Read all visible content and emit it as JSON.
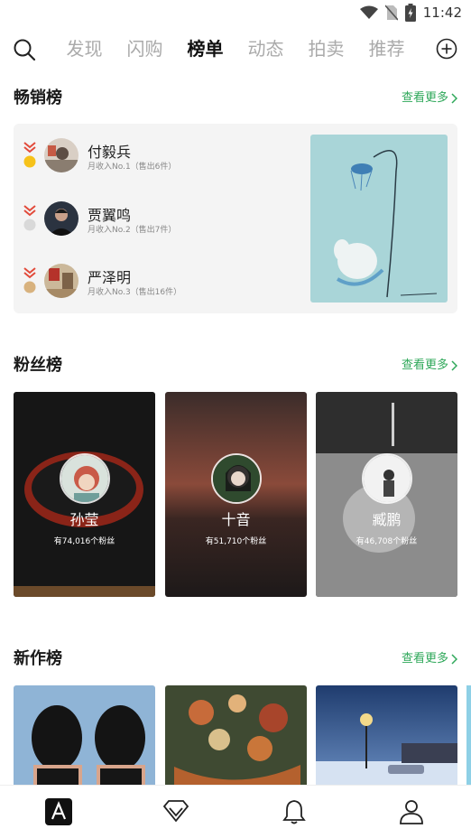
{
  "status_bar": {
    "time": "11:42",
    "icons": [
      "wifi-icon",
      "no-sim-icon",
      "battery-charging-icon"
    ]
  },
  "top_nav": {
    "tabs": [
      {
        "label": "发现",
        "active": false
      },
      {
        "label": "闪购",
        "active": false
      },
      {
        "label": "榜单",
        "active": true
      },
      {
        "label": "动态",
        "active": false
      },
      {
        "label": "拍卖",
        "active": false
      },
      {
        "label": "推荐",
        "active": false
      }
    ]
  },
  "bestseller": {
    "title": "畅销榜",
    "more": "查看更多",
    "items": [
      {
        "name": "付毅兵",
        "sub": "月收入No.1（售出6件）",
        "medal": "#f6c21a"
      },
      {
        "name": "贾翼鸣",
        "sub": "月收入No.2（售出7件）",
        "medal": "#d9d9d9"
      },
      {
        "name": "严泽明",
        "sub": "月收入No.3（售出16件）",
        "medal": "#d8b27e"
      }
    ]
  },
  "fans": {
    "title": "粉丝榜",
    "more": "查看更多",
    "items": [
      {
        "name": "孙莹",
        "count": "有74,016个粉丝"
      },
      {
        "name": "十音",
        "count": "有51,710个粉丝"
      },
      {
        "name": "臧鹏",
        "count": "有46,708个粉丝"
      }
    ]
  },
  "new_works": {
    "title": "新作榜",
    "more": "查看更多"
  },
  "bottom_nav": [
    "home-logo-icon",
    "diamond-icon",
    "bell-icon",
    "profile-icon"
  ],
  "colors": {
    "accent_green": "#2fa85a",
    "rank_arrow": "#e24a3a"
  }
}
